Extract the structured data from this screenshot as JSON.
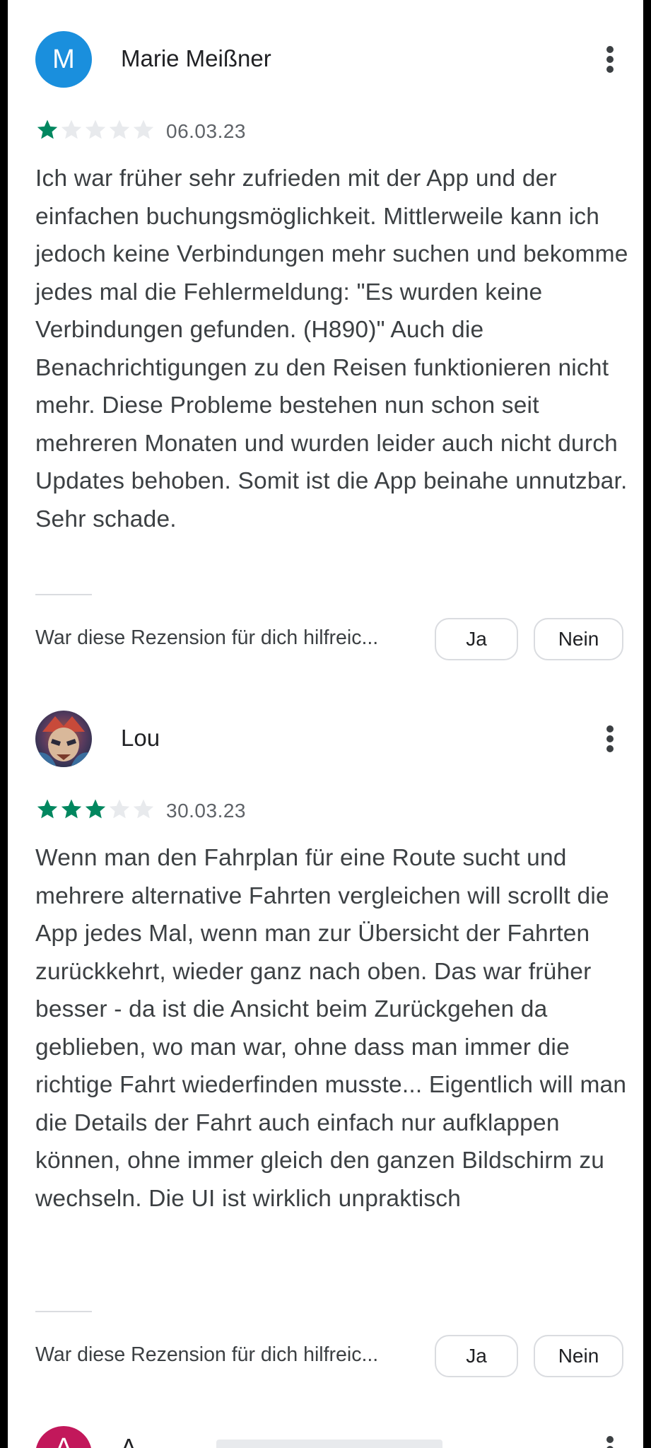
{
  "reviews": [
    {
      "author": "Marie Meißner",
      "avatar_letter": "M",
      "avatar_color": "#1a8fdd",
      "rating": 1,
      "date": "06.03.23",
      "text": "Ich war früher sehr zufrieden mit der App und der einfachen buchungsmöglichkeit. Mittlerweile kann ich jedoch keine Verbindungen mehr suchen und bekomme jedes mal die Fehlermeldung: \"Es wurden keine Verbindungen gefunden. (H890)\" Auch die Benachrichtigungen zu den Reisen funktionieren nicht mehr. Diese Probleme bestehen nun schon seit mehreren Monaten und wurden leider auch nicht durch Updates behoben. Somit ist die App beinahe unnutzbar. Sehr schade.",
      "helpful_question": "War diese Rezension für dich hilfreic...",
      "yes_label": "Ja",
      "no_label": "Nein"
    },
    {
      "author": "Lou",
      "rating": 3,
      "date": "30.03.23",
      "text": "Wenn man den Fahrplan für eine Route sucht und mehrere alternative Fahrten vergleichen will scrollt die App jedes Mal, wenn man zur Übersicht der Fahrten zurückkehrt, wieder ganz nach oben. Das war früher besser - da ist die Ansicht beim Zurückgehen da geblieben, wo man war, ohne dass man immer die richtige Fahrt wiederfinden musste... Eigentlich will man die Details der Fahrt auch einfach nur aufklappen können, ohne immer gleich den ganzen Bildschirm zu wechseln. Die UI ist wirklich unpraktisch",
      "helpful_question": "War diese Rezension für dich hilfreic...",
      "yes_label": "Ja",
      "no_label": "Nein"
    }
  ],
  "next_review": {
    "avatar_letter": "A",
    "author_partial": "A"
  },
  "colors": {
    "star_filled": "#01875f",
    "star_empty": "#e8eaed"
  }
}
